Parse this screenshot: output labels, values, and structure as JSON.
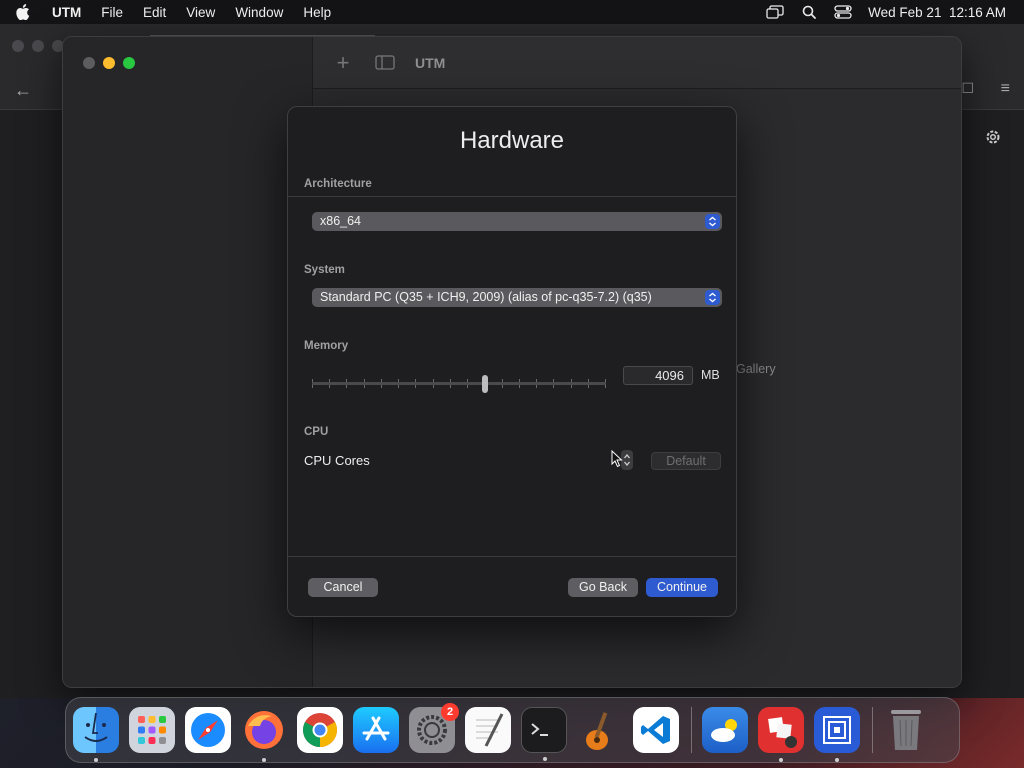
{
  "menubar": {
    "app_name": "UTM",
    "menus": [
      "File",
      "Edit",
      "View",
      "Window",
      "Help"
    ],
    "datetime": "Wed Feb 21  12:16 AM"
  },
  "utm": {
    "title": "UTM",
    "gallery_partial": "Gallery"
  },
  "sheet": {
    "title": "Hardware",
    "architecture": {
      "label": "Architecture",
      "value": "x86_64"
    },
    "system": {
      "label": "System",
      "value": "Standard PC (Q35 + ICH9, 2009) (alias of pc-q35-7.2) (q35)"
    },
    "memory": {
      "label": "Memory",
      "value": "4096",
      "unit": "MB",
      "slider_fraction": 0.59
    },
    "cpu": {
      "label": "CPU",
      "cores_label": "CPU Cores",
      "default_label": "Default"
    },
    "buttons": {
      "cancel": "Cancel",
      "go_back": "Go Back",
      "continue": "Continue"
    }
  },
  "dock": {
    "items": [
      {
        "name": "Finder",
        "icon": "finder-icon"
      },
      {
        "name": "Launchpad",
        "icon": "launchpad-icon"
      },
      {
        "name": "Safari",
        "icon": "safari-icon"
      },
      {
        "name": "Firefox",
        "icon": "firefox-icon"
      },
      {
        "name": "Chrome",
        "icon": "chrome-icon"
      },
      {
        "name": "App Store",
        "icon": "app-store-icon"
      },
      {
        "name": "System Settings",
        "icon": "system-settings-icon",
        "badge": "2"
      },
      {
        "name": "TextEdit",
        "icon": "textedit-icon"
      },
      {
        "name": "Terminal",
        "icon": "terminal-icon"
      },
      {
        "name": "GarageBand",
        "icon": "garageband-icon"
      },
      {
        "name": "Visual Studio Code",
        "icon": "vscode-icon"
      },
      {
        "name": "Weather",
        "icon": "weather-icon"
      },
      {
        "name": "Photo Booth",
        "icon": "photo-booth-icon"
      },
      {
        "name": "UTM",
        "icon": "utm-icon"
      },
      {
        "name": "Trash",
        "icon": "trash-icon"
      }
    ]
  },
  "colors": {
    "accent": "#2f5bd1",
    "traffic_min": "#febc2e",
    "traffic_max": "#28c840",
    "badge": "#ff3b30"
  }
}
